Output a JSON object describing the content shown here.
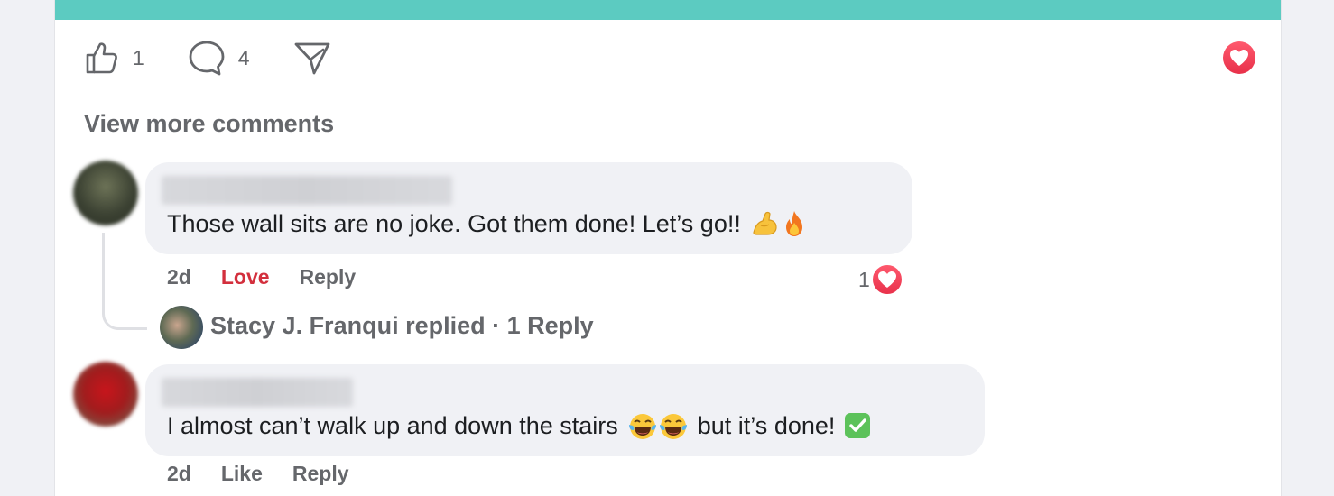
{
  "post_actions": {
    "like_count": "1",
    "comment_count": "4"
  },
  "comments_section": {
    "view_more": "View more comments",
    "comments": [
      {
        "text": "Those wall sits are no joke. Got them done! Let’s go!!",
        "emojis": [
          "💪",
          "🔥"
        ],
        "time": "2d",
        "reaction_label": "Love",
        "reply_label": "Reply",
        "reaction_count": "1",
        "replies_summary": "Stacy J. Franqui replied · 1 Reply"
      },
      {
        "text_before": "I almost can’t walk up and down the stairs",
        "emojis_mid": "😂😂",
        "text_after": "but it’s done!",
        "emoji_end": "✅",
        "time": "2d",
        "reaction_label": "Like",
        "reply_label": "Reply"
      }
    ]
  },
  "colors": {
    "accent_teal": "#5ccbc1",
    "love_red": "#d32f3d",
    "heart_gradient": "#f2405a"
  }
}
